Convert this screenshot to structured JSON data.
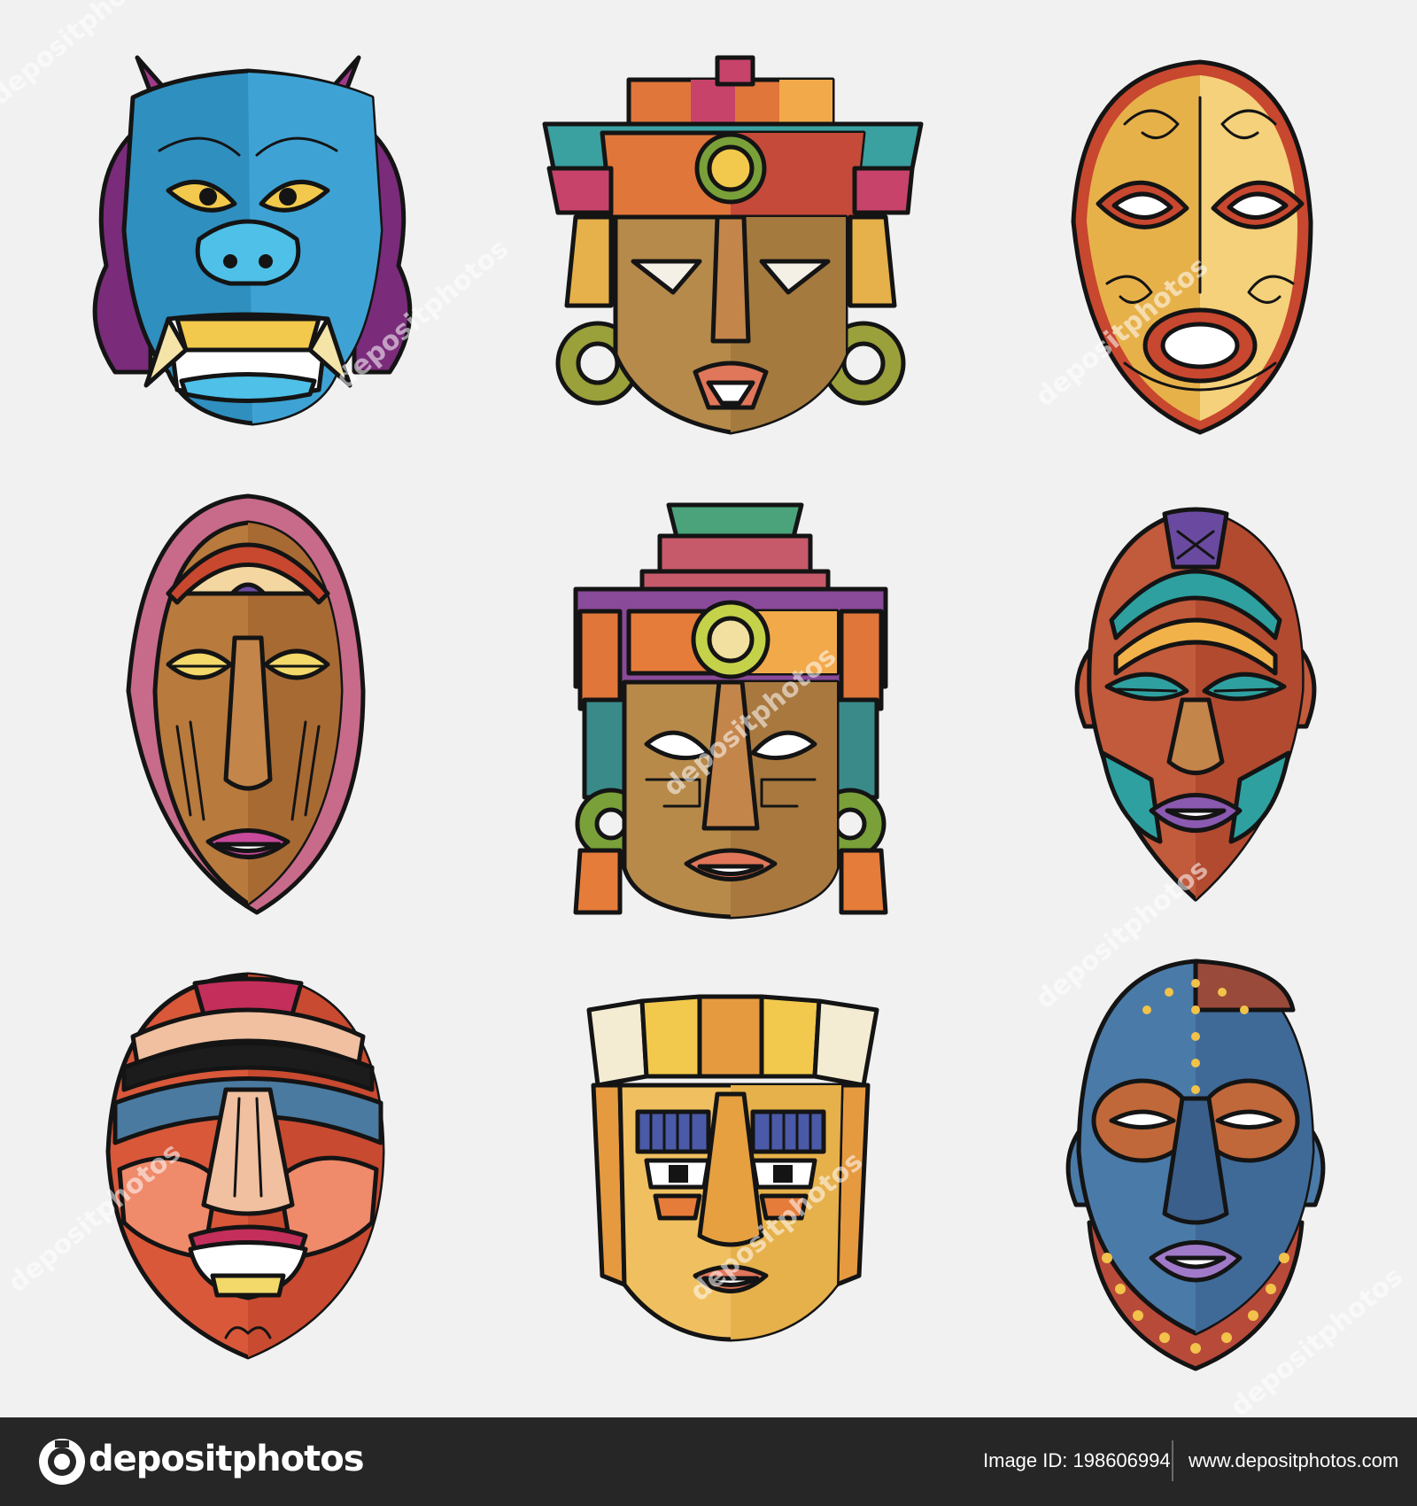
{
  "watermark": {
    "text": "depositphotos",
    "color": "#ffffff"
  },
  "masks": [
    {
      "name": "blue-demon-mask",
      "colors": [
        "#2f8fbf",
        "#4fc0e8",
        "#7a2b7a",
        "#f2c94c"
      ]
    },
    {
      "name": "aztec-headdress-mask",
      "colors": [
        "#b58a4a",
        "#e0763a",
        "#3aa0a0",
        "#c4d24a"
      ]
    },
    {
      "name": "swirl-ornament-mask",
      "colors": [
        "#e7b14a",
        "#c8472f",
        "#f4d17a"
      ]
    },
    {
      "name": "closed-eye-wood-mask",
      "colors": [
        "#b87a3d",
        "#c86a8a",
        "#f4d7a0"
      ]
    },
    {
      "name": "mayan-feather-mask",
      "colors": [
        "#b88a4a",
        "#4aa37a",
        "#e67c3a",
        "#c75a6a"
      ]
    },
    {
      "name": "african-painted-mask",
      "colors": [
        "#c25a3c",
        "#2fa0a0",
        "#f2b24a",
        "#6a4aa0"
      ]
    },
    {
      "name": "red-wave-mask",
      "colors": [
        "#d9583a",
        "#4a7aa0",
        "#f0c0a0",
        "#c42e5a"
      ]
    },
    {
      "name": "golden-block-mask",
      "colors": [
        "#f0c060",
        "#4a5aa8",
        "#e69a40"
      ]
    },
    {
      "name": "studded-blue-mask",
      "colors": [
        "#4a7aa8",
        "#c0683a",
        "#b84a3a",
        "#f2c24a"
      ]
    }
  ],
  "footer": {
    "logo_text": "depositphotos",
    "image_id": "Image ID: 198606994",
    "site": "www.depositphotos.com",
    "background": "#262626"
  }
}
